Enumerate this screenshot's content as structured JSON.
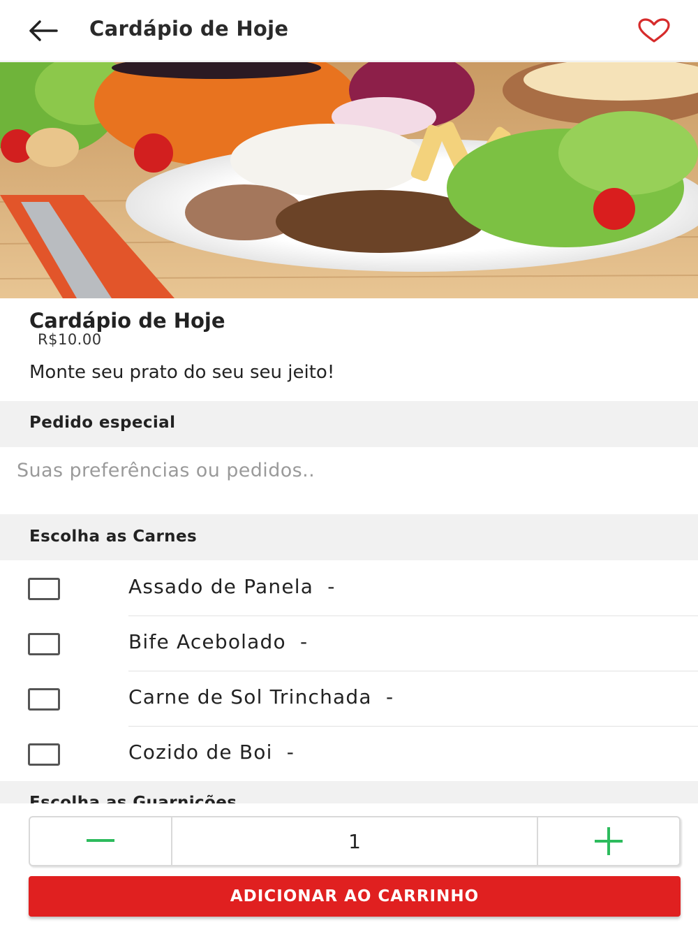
{
  "header": {
    "title": "Cardápio de Hoje",
    "back_icon": "arrow-left-icon",
    "favorite_icon": "heart-outline-icon",
    "favorite_color": "#d62b2b"
  },
  "product": {
    "name": "Cardápio de Hoje",
    "price": "R$10.00",
    "description": "Monte seu prato do seu seu jeito!"
  },
  "special_request": {
    "title": "Pedido especial",
    "placeholder": "Suas preferências ou pedidos.."
  },
  "meats": {
    "title": "Escolha as Carnes",
    "options": [
      {
        "label": "Assado de Panela  -",
        "checked": false
      },
      {
        "label": "Bife Acebolado  -",
        "checked": false
      },
      {
        "label": "Carne de Sol Trinchada  -",
        "checked": false
      },
      {
        "label": "Cozido de Boi  -",
        "checked": false
      }
    ]
  },
  "sides": {
    "title": "Escolha as Guarnições"
  },
  "quantity": {
    "value": "1",
    "minus_icon": "minus-icon",
    "plus_icon": "plus-icon",
    "accent_color": "#2dbb5d"
  },
  "cart": {
    "button_label": "ADICIONAR AO CARRINHO",
    "button_color": "#e02020"
  }
}
